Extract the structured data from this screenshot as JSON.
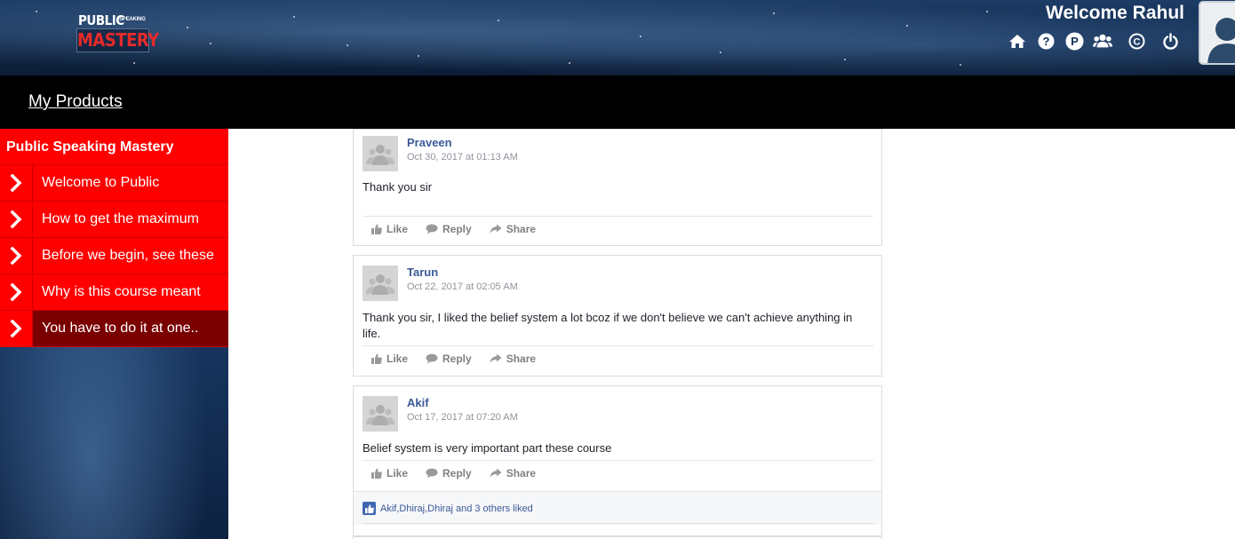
{
  "header": {
    "logo": {
      "top": "PUBLIC",
      "small": "SPEAKING",
      "bottom": "MASTERY"
    },
    "welcome": "Welcome Rahul",
    "icons": [
      "home-icon",
      "help-icon",
      "paypal-icon",
      "users-icon",
      "copyright-icon",
      "power-icon"
    ]
  },
  "topbar": {
    "my_products": "My Products"
  },
  "sidebar": {
    "title": "Public Speaking Mastery",
    "items": [
      {
        "label": "Welcome to Public"
      },
      {
        "label": "How to get the maximum"
      },
      {
        "label": "Before we begin, see these"
      },
      {
        "label": "Why is this course meant"
      },
      {
        "label": "You have to do it at one.."
      }
    ],
    "active_index": 4
  },
  "actions": {
    "like": "Like",
    "reply": "Reply",
    "share": "Share"
  },
  "comments": [
    {
      "author": "Praveen",
      "date": "Oct 30, 2017 at 01:13 AM",
      "text": "Thank you sir"
    },
    {
      "author": "Tarun",
      "date": "Oct 22, 2017 at 02:05 AM",
      "text": "Thank you sir, I liked the belief system a lot bcoz if we don't believe we can't achieve anything in life."
    },
    {
      "author": "Akif",
      "date": "Oct 17, 2017 at 07:20 AM",
      "text": "Belief system is very important part these course",
      "liked_by": "Akif,Dhiraj,Dhiraj and 3 others liked"
    }
  ],
  "colors": {
    "brand_red": "#fe0000",
    "active_item": "#7a0000",
    "author_blue": "#3b5998",
    "nav_black": "#000000"
  }
}
